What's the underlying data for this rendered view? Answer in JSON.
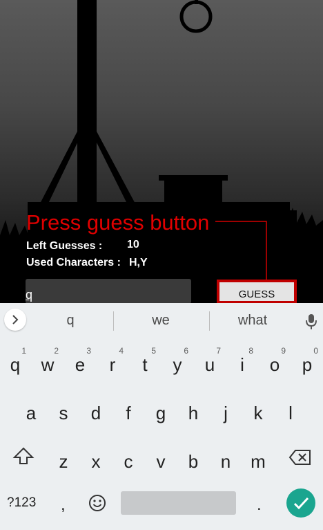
{
  "annotation": {
    "text": "Press guess button"
  },
  "stats": {
    "left_guesses_label": "Left Guesses :",
    "left_guesses_value": "10",
    "used_chars_label": "Used Characters :",
    "used_chars_value": "H,Y"
  },
  "input": {
    "value": "q"
  },
  "guess_button": {
    "label": "GUESS"
  },
  "keyboard": {
    "suggestions": [
      "q",
      "we",
      "what"
    ],
    "row1": [
      {
        "k": "q",
        "h": "1"
      },
      {
        "k": "w",
        "h": "2"
      },
      {
        "k": "e",
        "h": "3"
      },
      {
        "k": "r",
        "h": "4"
      },
      {
        "k": "t",
        "h": "5"
      },
      {
        "k": "y",
        "h": "6"
      },
      {
        "k": "u",
        "h": "7"
      },
      {
        "k": "i",
        "h": "8"
      },
      {
        "k": "o",
        "h": "9"
      },
      {
        "k": "p",
        "h": "0"
      }
    ],
    "row2": [
      "a",
      "s",
      "d",
      "f",
      "g",
      "h",
      "j",
      "k",
      "l"
    ],
    "row3": [
      "z",
      "x",
      "c",
      "v",
      "b",
      "n",
      "m"
    ],
    "symbols_label": "?123",
    "comma": ",",
    "period": "."
  },
  "icons": {
    "expand": "chevron-right-icon",
    "mic": "microphone-icon",
    "shift": "shift-icon",
    "backspace": "backspace-icon",
    "emoji": "emoji-icon",
    "enter": "checkmark-icon"
  },
  "colors": {
    "annotation": "#e00000",
    "enter": "#1aa58f",
    "keyboard_bg": "#eceff1"
  }
}
